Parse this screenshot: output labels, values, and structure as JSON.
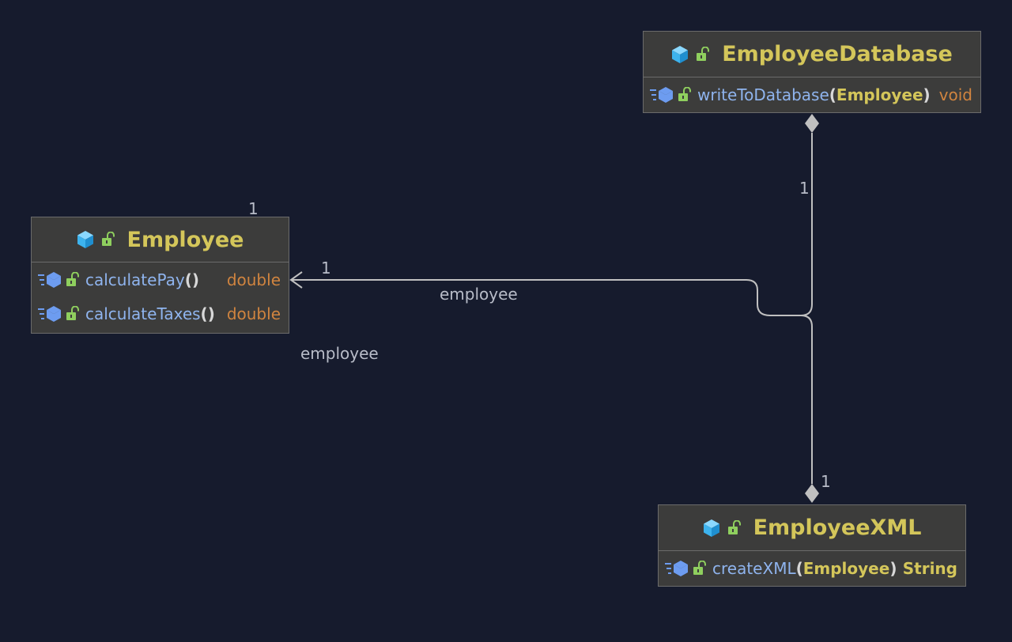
{
  "classes": {
    "employee": {
      "name": "Employee",
      "methods": [
        {
          "name": "calculatePay",
          "open": "(",
          "params": "",
          "close": ")",
          "return_type": "double"
        },
        {
          "name": "calculateTaxes",
          "open": "(",
          "params": "",
          "close": ")",
          "return_type": "double"
        }
      ]
    },
    "employee_database": {
      "name": "EmployeeDatabase",
      "methods": [
        {
          "name": "writeToDatabase",
          "open": "(",
          "params": "Employee",
          "close": ")",
          "return_type": "void"
        }
      ]
    },
    "employee_xml": {
      "name": "EmployeeXML",
      "methods": [
        {
          "name": "createXML",
          "open": "(",
          "params": "Employee",
          "close": ")",
          "return_type": "String"
        }
      ]
    }
  },
  "labels": {
    "mult_employee_top": "1",
    "mult_arrow_end": "1",
    "role_upper": "employee",
    "role_lower": "employee",
    "mult_database": "1",
    "mult_xml": "1"
  },
  "icons": {
    "class": "cube-icon",
    "visibility": "unlock-icon",
    "method": "method-icon"
  },
  "colors": {
    "background": "#161b2d",
    "box_fill": "#3c3c3b",
    "class_name": "#d4c65a",
    "method_name": "#8fb4ee",
    "primitive_type": "#d0843f",
    "connector": "#c0c0c0"
  }
}
